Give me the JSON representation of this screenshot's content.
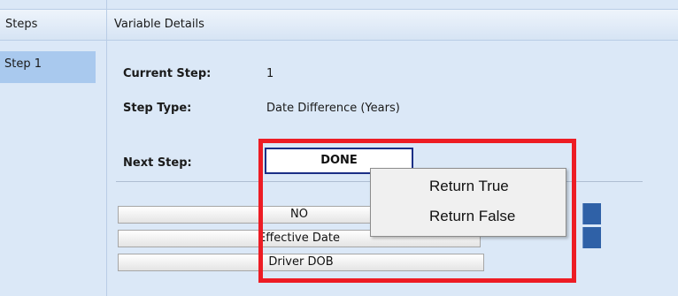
{
  "steps_panel": {
    "header": "Steps",
    "items": [
      {
        "label": "Step 1",
        "selected": true
      }
    ]
  },
  "details_panel": {
    "header": "Variable Details",
    "current_step_label": "Current Step:",
    "current_step_value": "1",
    "step_type_label": "Step Type:",
    "step_type_value": "Date Difference (Years)",
    "next_step_label": "Next Step:",
    "next_step_value": "DONE",
    "variable_buttons": [
      {
        "label": "NO"
      },
      {
        "label": "Effective Date"
      },
      {
        "label": "Driver DOB"
      }
    ]
  },
  "context_menu": {
    "items": [
      {
        "label": "Return True"
      },
      {
        "label": "Return False"
      }
    ]
  },
  "colors": {
    "panel_background": "#dbe8f7",
    "selected_step": "#a9c9ee",
    "dropdown_border": "#1b2f86",
    "highlight": "#ed1c24",
    "side_button": "#2f61a7"
  }
}
